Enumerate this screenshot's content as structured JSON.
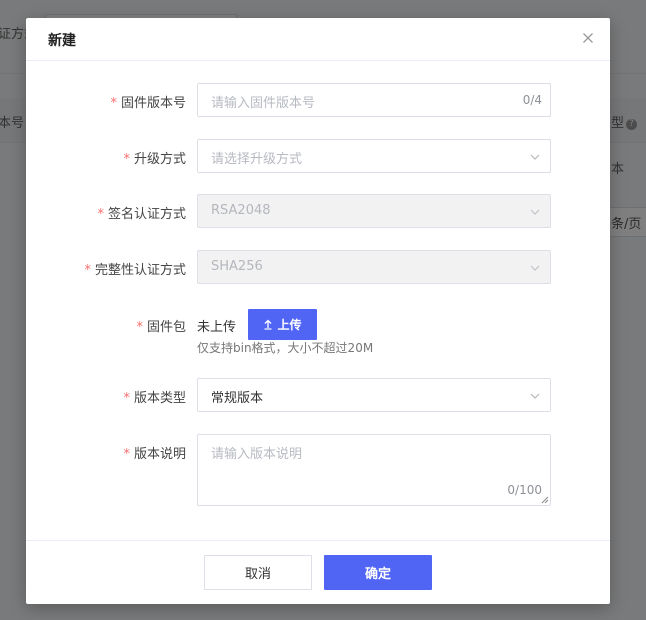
{
  "background": {
    "fragment_field_label": "证方式",
    "fragment_col_left": "本号",
    "fragment_col_right": "型",
    "fragment_row_right": "本",
    "fragment_pager": "条/页"
  },
  "dialog": {
    "title": "新建",
    "close_icon": "close-icon",
    "fields": {
      "firmware_version": {
        "label": "固件版本号",
        "placeholder": "请输入固件版本号",
        "counter": "0/4"
      },
      "upgrade_method": {
        "label": "升级方式",
        "placeholder": "请选择升级方式"
      },
      "signature_auth": {
        "label": "签名认证方式",
        "value": "RSA2048"
      },
      "integrity_auth": {
        "label": "完整性认证方式",
        "value": "SHA256"
      },
      "firmware_package": {
        "label": "固件包",
        "status": "未上传",
        "upload_label": "上传",
        "hint": "仅支持bin格式，大小不超过20M"
      },
      "version_type": {
        "label": "版本类型",
        "value": "常规版本"
      },
      "version_description": {
        "label": "版本说明",
        "placeholder": "请输入版本说明",
        "counter": "0/100"
      }
    },
    "footer": {
      "cancel_label": "取消",
      "ok_label": "确定"
    }
  },
  "colors": {
    "primary": "#5165f5",
    "required_mark": "#f56c6c",
    "overlay": "rgba(0,0,0,0.5)"
  }
}
